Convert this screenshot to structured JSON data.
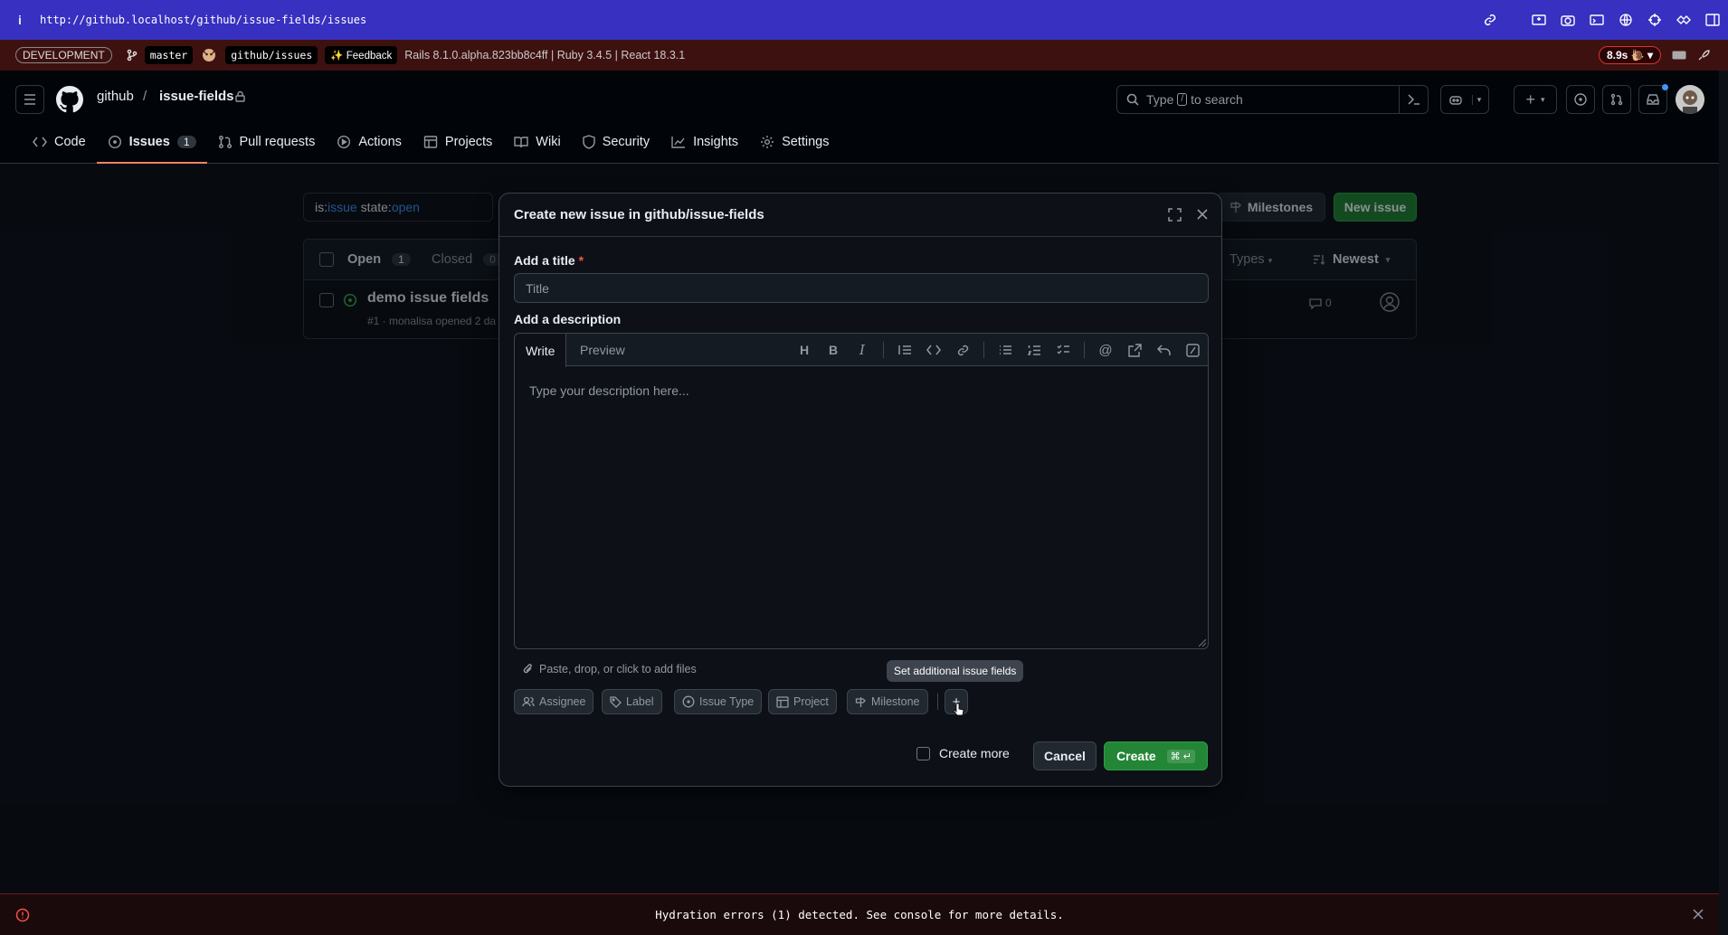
{
  "browser": {
    "url": "http://github.localhost/github/issue-fields/issues",
    "info_label": "i"
  },
  "devbar": {
    "env_label": "DEVELOPMENT",
    "branch": "master",
    "repo_chip": "github/issues",
    "feedback": "✨ Feedback",
    "rails_info": "Rails 8.1.0.alpha.823bb8c4ff | Ruby 3.4.5 | React 18.3.1",
    "timer": "8.9s"
  },
  "header": {
    "owner": "github",
    "separator": "/",
    "repo": "issue-fields",
    "search_prefix": "Type",
    "search_key": "/",
    "search_suffix": "to search"
  },
  "tabs": [
    {
      "label": "Code",
      "icon": "code-icon"
    },
    {
      "label": "Issues",
      "count": "1",
      "icon": "issue-opened-icon"
    },
    {
      "label": "Pull requests",
      "icon": "git-pull-request-icon"
    },
    {
      "label": "Actions",
      "icon": "play-icon"
    },
    {
      "label": "Projects",
      "icon": "table-icon"
    },
    {
      "label": "Wiki",
      "icon": "book-icon"
    },
    {
      "label": "Security",
      "icon": "shield-icon"
    },
    {
      "label": "Insights",
      "icon": "graph-icon"
    },
    {
      "label": "Settings",
      "icon": "gear-icon"
    }
  ],
  "issues_page": {
    "filter_prefix": "is:",
    "filter_is": "issue",
    "filter_state_prefix": " state:",
    "filter_state": "open",
    "milestones_label": "Milestones",
    "new_issue_label": "New issue",
    "open_label": "Open",
    "open_count": "1",
    "closed_label": "Closed",
    "closed_count": "0",
    "types_label": "Types",
    "sort_label": "Newest",
    "issue_title": "demo issue fields",
    "issue_meta": "#1 · monalisa opened 2 da",
    "comment_count": "0"
  },
  "modal": {
    "title": "Create new issue in github/issue-fields",
    "title_label": "Add a title",
    "required_mark": "*",
    "title_placeholder": "Title",
    "description_label": "Add a description",
    "write_tab": "Write",
    "preview_tab": "Preview",
    "description_placeholder": "Type your description here...",
    "attach_hint": "Paste, drop, or click to add files",
    "meta_buttons": {
      "assignee": "Assignee",
      "label": "Label",
      "issue_type": "Issue Type",
      "project": "Project",
      "milestone": "Milestone"
    },
    "tooltip": "Set additional issue fields",
    "create_more_label": "Create more",
    "cancel_label": "Cancel",
    "create_label": "Create",
    "create_shortcut": "⌘ ↵"
  },
  "error_bar": {
    "message": "Hydration errors (1) detected. See console for more details."
  },
  "colors": {
    "accent_green": "#238636",
    "url_bar": "#3730c0",
    "dev_bar": "#3d1110",
    "tab_underline": "#f78166",
    "link_blue": "#4493f8"
  }
}
